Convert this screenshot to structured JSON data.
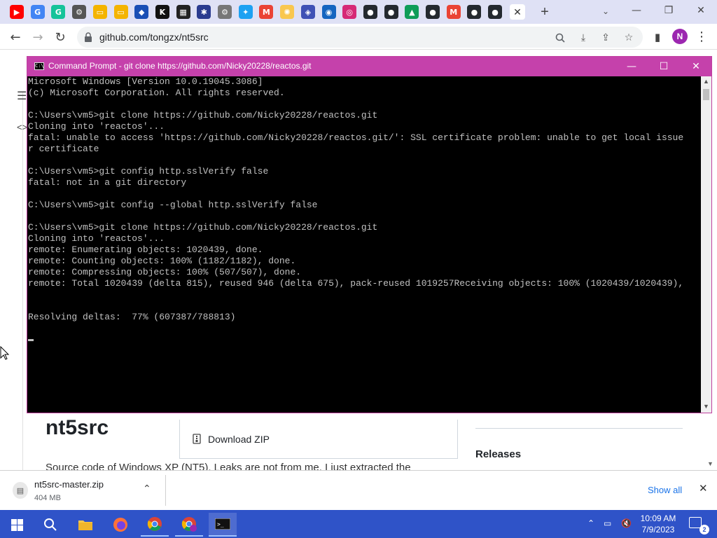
{
  "browser": {
    "url": "github.com/tongzx/nt5src",
    "profile_initial": "N",
    "tab_close_glyph": "✕",
    "new_tab_glyph": "+",
    "favicons": [
      {
        "name": "youtube-icon",
        "color": "#ff0000",
        "glyph": "▶"
      },
      {
        "name": "google-icon",
        "color": "#4285f4",
        "glyph": "G"
      },
      {
        "name": "grammarly-icon",
        "color": "#15c39a",
        "glyph": "G"
      },
      {
        "name": "gear-icon",
        "color": "#555555",
        "glyph": "⚙"
      },
      {
        "name": "folder-icon",
        "color": "#f4b400",
        "glyph": "▭"
      },
      {
        "name": "folder-icon",
        "color": "#f4b400",
        "glyph": "▭"
      },
      {
        "name": "app-icon",
        "color": "#1a4fb5",
        "glyph": "◆"
      },
      {
        "name": "kim-icon",
        "color": "#111111",
        "glyph": "K"
      },
      {
        "name": "qr-icon",
        "color": "#222222",
        "glyph": "▦"
      },
      {
        "name": "app-icon",
        "color": "#2a3b8f",
        "glyph": "✱"
      },
      {
        "name": "settings-icon",
        "color": "#777777",
        "glyph": "⚙"
      },
      {
        "name": "twitter-icon",
        "color": "#1da1f2",
        "glyph": "✦"
      },
      {
        "name": "gmail-icon",
        "color": "#ea4335",
        "glyph": "M"
      },
      {
        "name": "bulb-icon",
        "color": "#f9c74f",
        "glyph": "✺"
      },
      {
        "name": "app-icon",
        "color": "#3f51b5",
        "glyph": "◈"
      },
      {
        "name": "sonic-icon",
        "color": "#1565c0",
        "glyph": "◉"
      },
      {
        "name": "instagram-icon",
        "color": "#d62976",
        "glyph": "◎"
      },
      {
        "name": "github-icon",
        "color": "#24292f",
        "glyph": "●"
      },
      {
        "name": "github-icon",
        "color": "#24292f",
        "glyph": "●"
      },
      {
        "name": "drive-icon",
        "color": "#0f9d58",
        "glyph": "▲"
      },
      {
        "name": "github-icon",
        "color": "#24292f",
        "glyph": "●"
      },
      {
        "name": "gmail-icon",
        "color": "#ea4335",
        "glyph": "M"
      },
      {
        "name": "github-icon",
        "color": "#24292f",
        "glyph": "●"
      },
      {
        "name": "github-icon",
        "color": "#24292f",
        "glyph": "●"
      }
    ]
  },
  "github_page": {
    "repo_title": "nt5src",
    "repo_description": "Source code of Windows XP (NT5). Leaks are not from me. I just extracted the",
    "download_zip": "Download ZIP",
    "releases": "Releases"
  },
  "cmd": {
    "title": "Command Prompt - git  clone https://github.com/Nicky20228/reactos.git",
    "lines": [
      "Microsoft Windows [Version 10.0.19045.3086]",
      "(c) Microsoft Corporation. All rights reserved.",
      "",
      "C:\\Users\\vm5>git clone https://github.com/Nicky20228/reactos.git",
      "Cloning into 'reactos'...",
      "fatal: unable to access 'https://github.com/Nicky20228/reactos.git/': SSL certificate problem: unable to get local issue",
      "r certificate",
      "",
      "C:\\Users\\vm5>git config http.sslVerify false",
      "fatal: not in a git directory",
      "",
      "C:\\Users\\vm5>git config --global http.sslVerify false",
      "",
      "C:\\Users\\vm5>git clone https://github.com/Nicky20228/reactos.git",
      "Cloning into 'reactos'...",
      "remote: Enumerating objects: 1020439, done.",
      "remote: Counting objects: 100% (1182/1182), done.",
      "remote: Compressing objects: 100% (507/507), done.",
      "remote: Total 1020439 (delta 815), reused 946 (delta 675), pack-reused 1019257Receiving objects: 100% (1020439/1020439),",
      "",
      "",
      "Resolving deltas:  77% (607387/788813)"
    ]
  },
  "download": {
    "filename": "nt5src-master.zip",
    "size": "404 MB",
    "show_all": "Show all"
  },
  "taskbar": {
    "time": "10:09 AM",
    "date": "7/9/2023",
    "notification_count": "2"
  }
}
